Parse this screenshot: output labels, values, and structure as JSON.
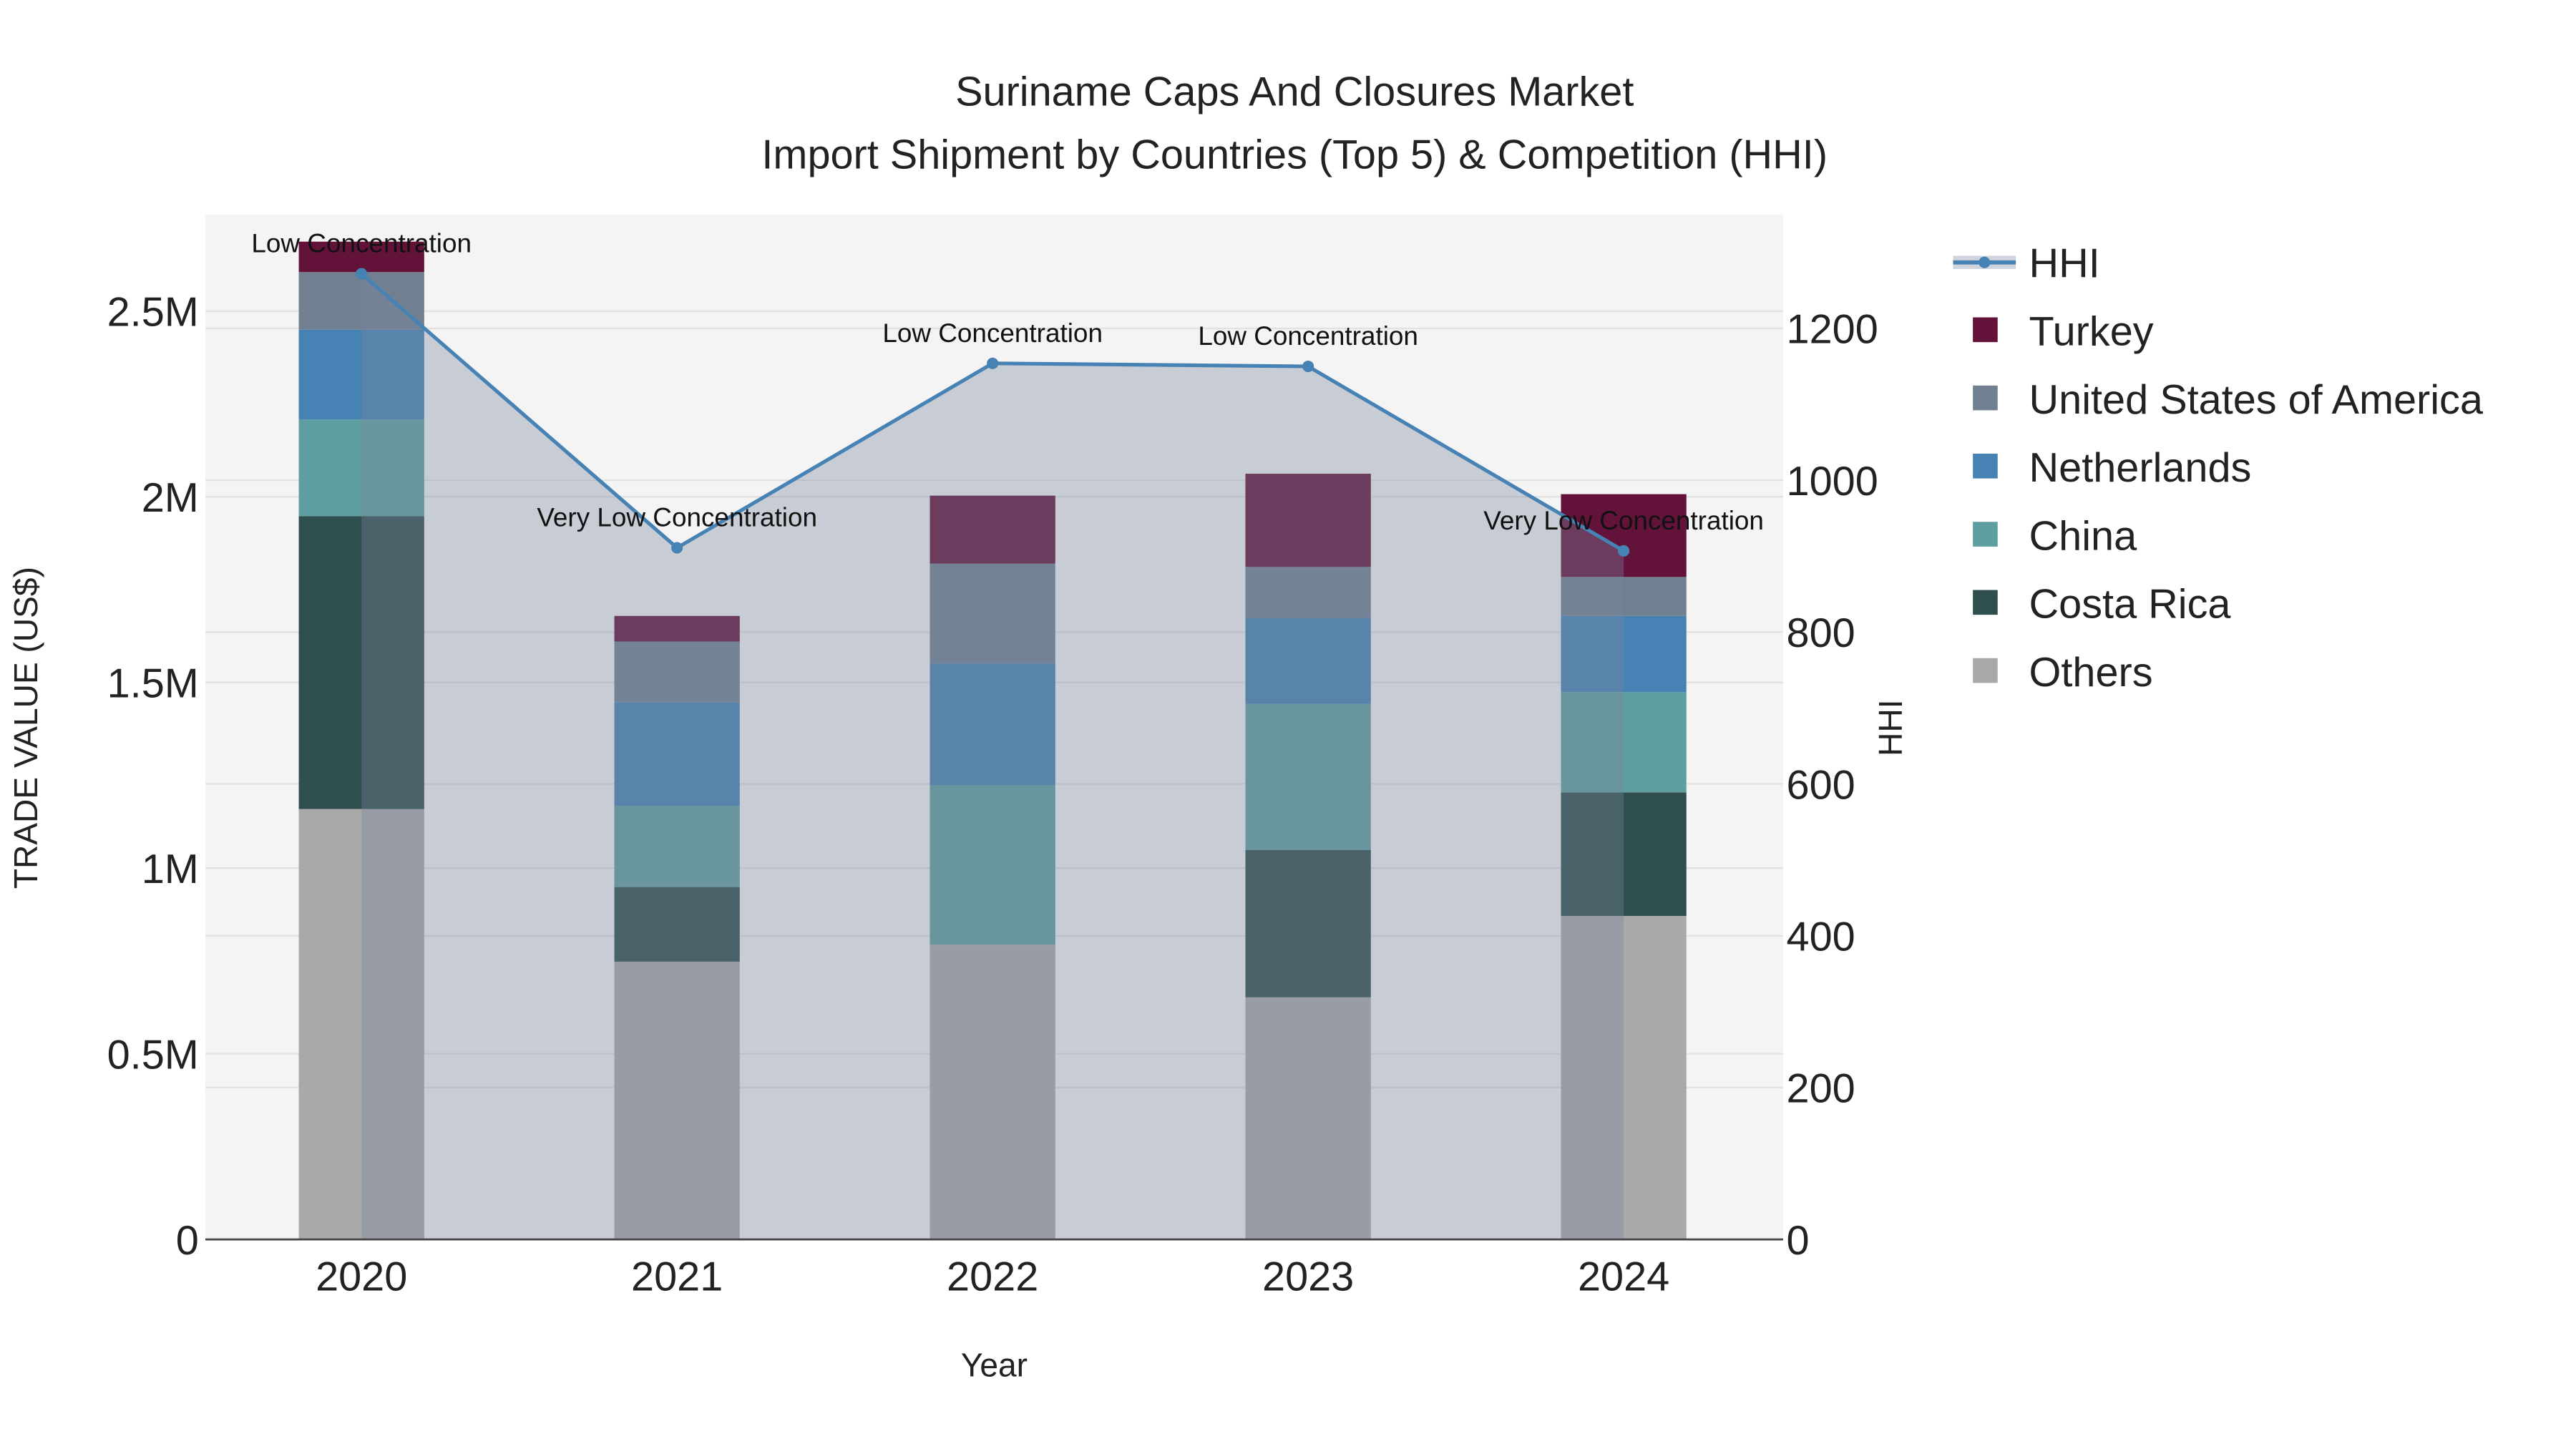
{
  "chart_data": {
    "type": "bar",
    "stacked": true,
    "title": "Suriname Caps And Closures Market",
    "subtitle": "Import Shipment by Countries (Top 5) & Competition (HHI)",
    "xlabel": "Year",
    "ylabel": "TRADE VALUE (US$)",
    "y2label": "HHI",
    "categories": [
      "2020",
      "2021",
      "2022",
      "2023",
      "2024"
    ],
    "ylim": [
      0,
      2760000
    ],
    "y2lim": [
      0,
      1350
    ],
    "yticks": [
      {
        "v": 0,
        "label": "0"
      },
      {
        "v": 500000,
        "label": "0.5M"
      },
      {
        "v": 1000000,
        "label": "1M"
      },
      {
        "v": 1500000,
        "label": "1.5M"
      },
      {
        "v": 2000000,
        "label": "2M"
      },
      {
        "v": 2500000,
        "label": "2.5M"
      }
    ],
    "y2ticks": [
      {
        "v": 0,
        "label": "0"
      },
      {
        "v": 200,
        "label": "200"
      },
      {
        "v": 400,
        "label": "400"
      },
      {
        "v": 600,
        "label": "600"
      },
      {
        "v": 800,
        "label": "800"
      },
      {
        "v": 1000,
        "label": "1000"
      },
      {
        "v": 1200,
        "label": "1200"
      }
    ],
    "series": [
      {
        "name": "Others",
        "color": "#a9a9a9",
        "values": [
          1159000,
          748000,
          794000,
          652000,
          871000
        ]
      },
      {
        "name": "Costa Rica",
        "color": "#2f4f4f",
        "values": [
          789000,
          201000,
          0,
          397000,
          333000
        ]
      },
      {
        "name": "China",
        "color": "#5f9ea0",
        "values": [
          260000,
          219000,
          429000,
          393000,
          270000
        ]
      },
      {
        "name": "Netherlands",
        "color": "#4682b4",
        "values": [
          242000,
          278000,
          328000,
          232000,
          205000
        ]
      },
      {
        "name": "United States of America",
        "color": "#708090",
        "values": [
          155000,
          164000,
          269000,
          137000,
          105000
        ]
      },
      {
        "name": "Turkey",
        "color": "#63133a",
        "values": [
          82000,
          69000,
          183000,
          251000,
          223000
        ]
      }
    ],
    "line": {
      "name": "HHI",
      "color": "#4682b4",
      "values": [
        1272,
        911,
        1154,
        1150,
        907
      ]
    },
    "annotations": [
      "Low Concentration",
      "Very Low Concentration",
      "Low Concentration",
      "Low Concentration",
      "Very Low Concentration"
    ],
    "legend_order": [
      "HHI",
      "Turkey",
      "United States of America",
      "Netherlands",
      "China",
      "Costa Rica",
      "Others"
    ],
    "legend_position": "right",
    "grid": true
  }
}
